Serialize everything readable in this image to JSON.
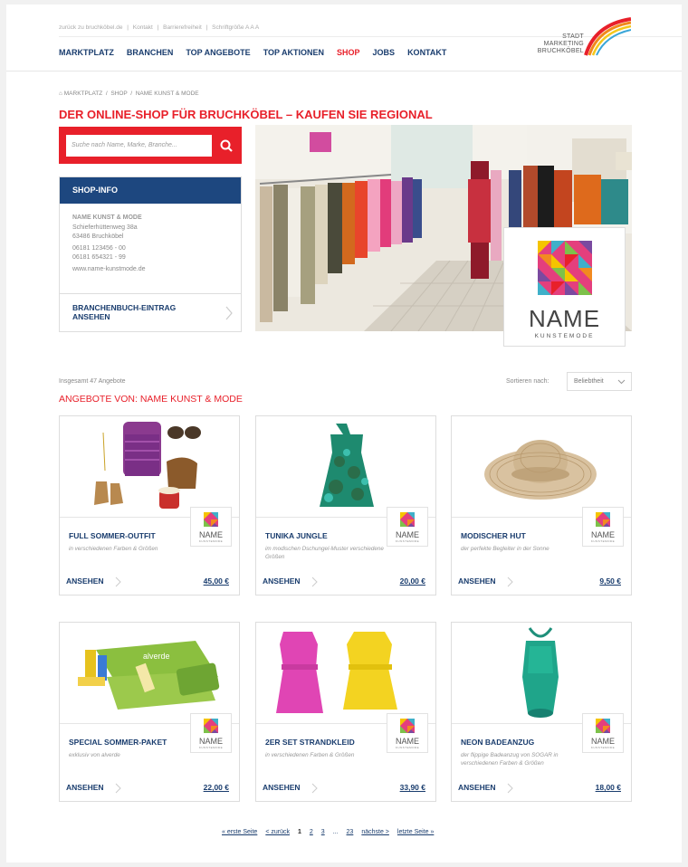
{
  "topbar": {
    "links": [
      "zurück zu bruchköbel.de",
      "Kontakt",
      "Barrierefreiheit",
      "Schriftgröße A A A"
    ],
    "separator": "|"
  },
  "nav": {
    "items": [
      {
        "label": "MARKTPLATZ"
      },
      {
        "label": "BRANCHEN"
      },
      {
        "label": "TOP ANGEBOTE"
      },
      {
        "label": "TOP AKTIONEN"
      },
      {
        "label": "SHOP",
        "active": true
      },
      {
        "label": "JOBS"
      },
      {
        "label": "KONTAKT"
      }
    ]
  },
  "logo": {
    "line1": "STADT",
    "line2": "MARKETING",
    "line3": "BRUCHKÖBEL"
  },
  "breadcrumb": {
    "home_icon": "home-icon",
    "items": [
      "MARKTPLATZ",
      "SHOP",
      "NAME KUNST & MODE"
    ],
    "separator": "/"
  },
  "headline": "DER ONLINE-SHOP FÜR BRUCHKÖBEL – KAUFEN SIE REGIONAL",
  "search": {
    "placeholder": "Suche nach Name, Marke, Branche...",
    "icon": "search-icon"
  },
  "shop_info": {
    "heading": "SHOP-INFO",
    "name": "NAME KUNST & MODE",
    "street": "Schieferhüttenweg 38a",
    "city": "63486 Bruchköbel",
    "phone": "06181 123456 - 00",
    "fax": "06181 654321 - 99",
    "web": "www.name-kunstmode.de",
    "directory_link_1": "BRANCHENBUCH-EINTRAG",
    "directory_link_2": "ANSEHEN"
  },
  "brand": {
    "name": "NAME",
    "sub": "KUNSTEMODE",
    "badge_sub": "KUNSTEMODE"
  },
  "listing": {
    "total": "Insgesamt 47 Angebote",
    "sort_label": "Sortieren nach:",
    "sort_value": "Beliebtheit",
    "heading": "ANGEBOTE VON: NAME KUNST & MODE"
  },
  "products": [
    {
      "title": "FULL SOMMER-OUTFIT",
      "desc": "in verschiedenen Farben & Größen",
      "view": "ANSEHEN",
      "price": "45,00 €"
    },
    {
      "title": "TUNIKA JUNGLE",
      "desc": "im modischen Dschungel-Muster verschiedene Größen",
      "view": "ANSEHEN",
      "price": "20,00 €"
    },
    {
      "title": "MODISCHER HUT",
      "desc": "der perfekte Begleiter in der Sonne",
      "view": "ANSEHEN",
      "price": "9,50 €"
    },
    {
      "title": "SPECIAL SOMMER-PAKET",
      "desc": "exklusiv von alverde",
      "view": "ANSEHEN",
      "price": "22,00 €"
    },
    {
      "title": "2ER SET STRANDKLEID",
      "desc": "in verschiedenen Farben & Größen",
      "view": "ANSEHEN",
      "price": "33,90 €"
    },
    {
      "title": "NEON BADEANZUG",
      "desc": "der flippige Badeanzug von SOGAR in verschiedenen Farben & Größen",
      "view": "ANSEHEN",
      "price": "18,00 €"
    }
  ],
  "pagination": {
    "first": "« erste Seite",
    "prev": "< zurück",
    "pages": [
      "1",
      "2",
      "3"
    ],
    "ellipsis": "...",
    "last_page": "23",
    "next": "nächste >",
    "last": "letzte Seite »"
  }
}
